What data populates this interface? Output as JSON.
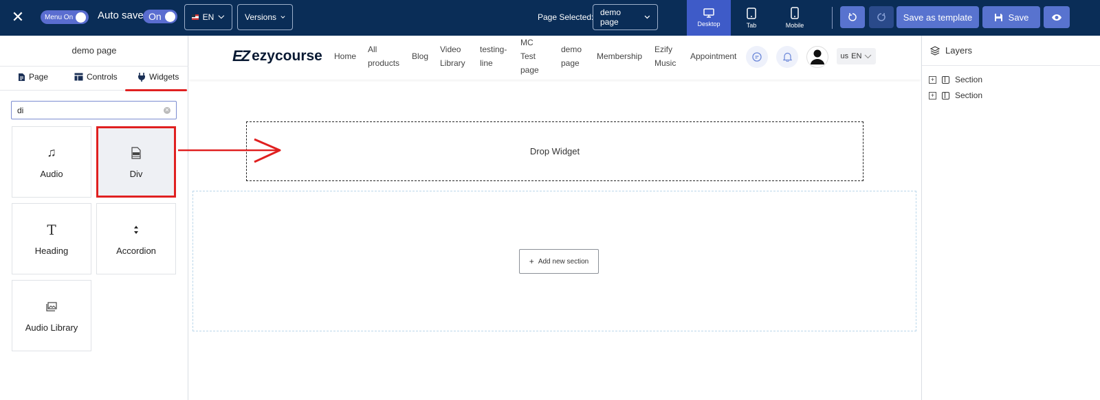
{
  "topbar": {
    "close_glyph": "✕",
    "menu_toggle": "Menu On",
    "autosave_label": "Auto save:",
    "autosave_state": "On",
    "language": "EN",
    "versions": "Versions",
    "page_selected_label": "Page Selected:",
    "page_selected_value": "demo page",
    "devices": {
      "desktop": "Desktop",
      "tab": "Tab",
      "mobile": "Mobile"
    },
    "save_template": "Save as template",
    "save": "Save",
    "accent_color": "#5873cf",
    "bar_color": "#0a2d57"
  },
  "left_panel": {
    "title": "demo page",
    "tabs": {
      "page": "Page",
      "controls": "Controls",
      "widgets": "Widgets"
    },
    "search_value": "di",
    "widgets": {
      "audio": "Audio",
      "div": "Div",
      "heading": "Heading",
      "accordion": "Accordion",
      "audio_library": "Audio Library"
    },
    "highlight_color": "#e02020"
  },
  "site": {
    "logo_mark": "EZ",
    "logo_text": "ezycourse",
    "nav": {
      "home": "Home",
      "all_products_1": "All",
      "all_products_2": "products",
      "blog": "Blog",
      "video_library_1": "Video",
      "video_library_2": "Library",
      "testing_line_1": "testing-",
      "testing_line_2": "line",
      "mc_test_1": "MC",
      "mc_test_2": "Test",
      "mc_test_3": "page",
      "demo_page_1": "demo",
      "demo_page_2": "page",
      "membership": "Membership",
      "ezify_music_1": "Ezify",
      "ezify_music_2": "Music",
      "appointment": "Appointment"
    },
    "lang_prefix": "us",
    "lang": "EN"
  },
  "canvas": {
    "drop_widget": "Drop Widget",
    "add_section": "Add new section"
  },
  "right_panel": {
    "title": "Layers",
    "layers": [
      "Section",
      "Section"
    ]
  }
}
